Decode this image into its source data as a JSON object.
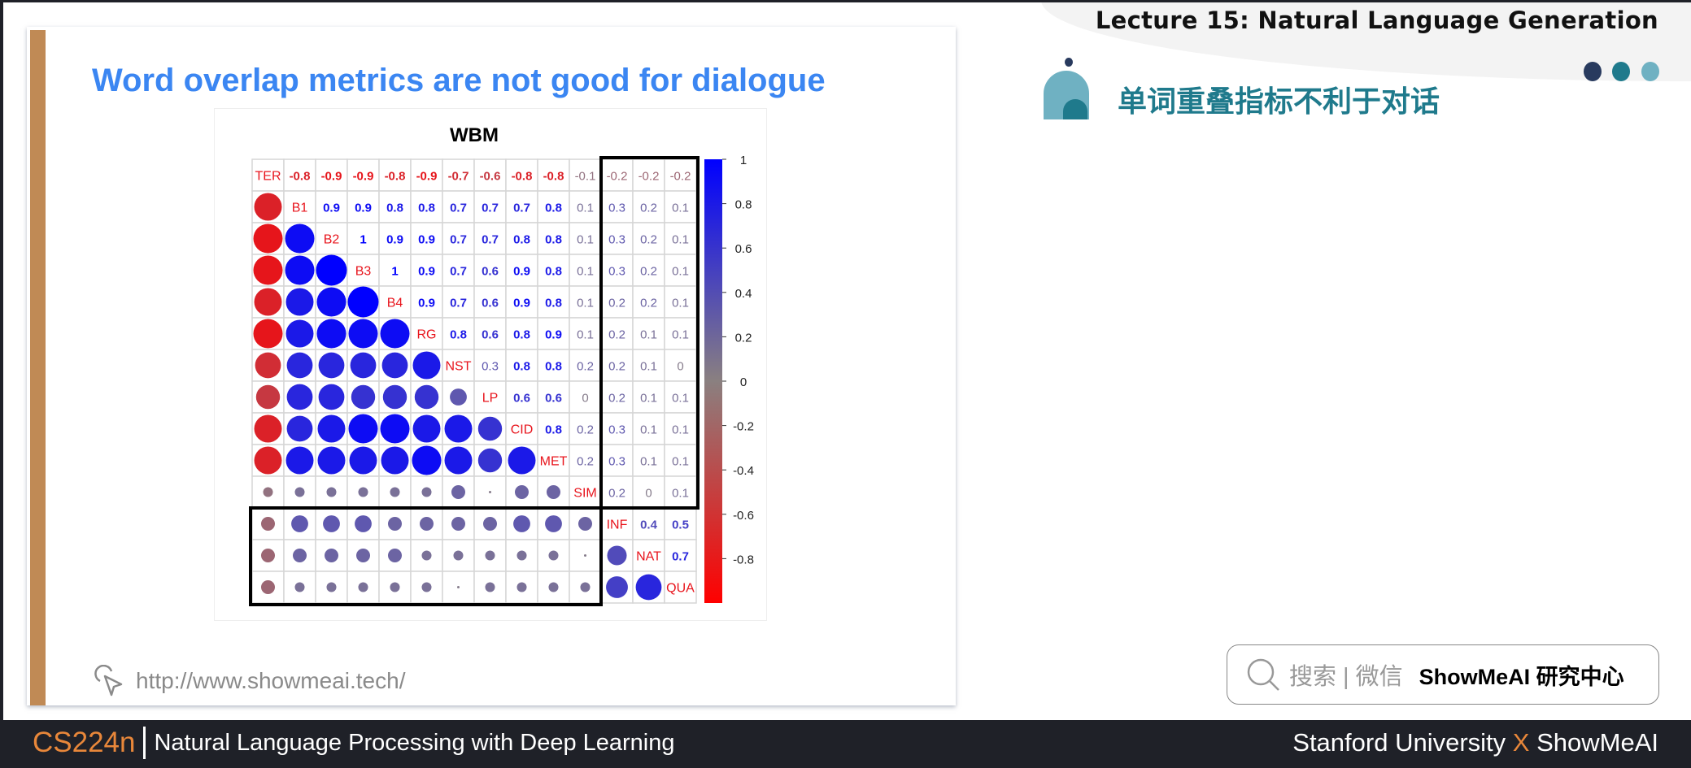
{
  "header": {
    "lecture_title": "Lecture 15: Natural Language Generation",
    "cn_title": "单词重叠指标不利于对话",
    "dots_colors": [
      "#283a5e",
      "#1f7a8c",
      "#6fb1c2"
    ]
  },
  "slide": {
    "title": "Word overlap metrics are not good for dialogue",
    "url": "http://www.showmeai.tech/",
    "accent_color": "#3b86f2",
    "stripe_color": "#c08a55"
  },
  "search": {
    "label": "搜索 | 微信",
    "brand": "ShowMeAI 研究中心"
  },
  "footer": {
    "course_code": "CS224n",
    "course_name": "Natural Language Processing with Deep Learning",
    "credit_left": "Stanford University",
    "credit_x": "X",
    "credit_right": "ShowMeAI"
  },
  "chart_data": {
    "type": "heatmap",
    "title": "WBM",
    "variables": [
      "TER",
      "B1",
      "B2",
      "B3",
      "B4",
      "RG",
      "NST",
      "LP",
      "CID",
      "MET",
      "SIM",
      "INF",
      "NAT",
      "QUA"
    ],
    "upper_triangle": [
      [
        "-0.8",
        "-0.9",
        "-0.9",
        "-0.8",
        "-0.9",
        "-0.7",
        "-0.6",
        "-0.8",
        "-0.8",
        "-0.1",
        "-0.2",
        "-0.2",
        "-0.2"
      ],
      [
        "0.9",
        "0.9",
        "0.8",
        "0.8",
        "0.7",
        "0.7",
        "0.7",
        "0.8",
        "0.1",
        "0.3",
        "0.2",
        "0.1"
      ],
      [
        "1",
        "0.9",
        "0.9",
        "0.7",
        "0.7",
        "0.8",
        "0.8",
        "0.1",
        "0.3",
        "0.2",
        "0.1"
      ],
      [
        "1",
        "0.9",
        "0.7",
        "0.6",
        "0.9",
        "0.8",
        "0.1",
        "0.3",
        "0.2",
        "0.1"
      ],
      [
        "0.9",
        "0.7",
        "0.6",
        "0.9",
        "0.8",
        "0.1",
        "0.2",
        "0.2",
        "0.1"
      ],
      [
        "0.8",
        "0.6",
        "0.8",
        "0.9",
        "0.1",
        "0.2",
        "0.1",
        "0.1"
      ],
      [
        "0.3",
        "0.8",
        "0.8",
        "0.2",
        "0.2",
        "0.1",
        "0"
      ],
      [
        "0.6",
        "0.6",
        "0",
        "0.2",
        "0.1",
        "0.1"
      ],
      [
        "0.8",
        "0.2",
        "0.3",
        "0.1",
        "0.1"
      ],
      [
        "0.2",
        "0.3",
        "0.1",
        "0.1"
      ],
      [
        "0.2",
        "0",
        "0.1"
      ],
      [
        "0.4",
        "0.5"
      ],
      [
        "0.7"
      ],
      []
    ],
    "lower_triangle": "circles sized and colored by correlation",
    "colorbar": {
      "range": [
        -1,
        1
      ],
      "ticks": [
        "1",
        "0.8",
        "0.6",
        "0.4",
        "0.2",
        "0",
        "-0.2",
        "-0.4",
        "-0.6",
        "-0.8"
      ],
      "colors": {
        "negative": "#ff0000",
        "zero": "#8a8080",
        "positive": "#0000ff"
      }
    },
    "highlight_boxes": [
      {
        "rows": [
          "TER",
          "SIM"
        ],
        "cols": [
          "INF",
          "QUA"
        ]
      },
      {
        "rows": [
          "INF",
          "QUA"
        ],
        "cols": [
          "TER",
          "SIM"
        ]
      }
    ]
  }
}
